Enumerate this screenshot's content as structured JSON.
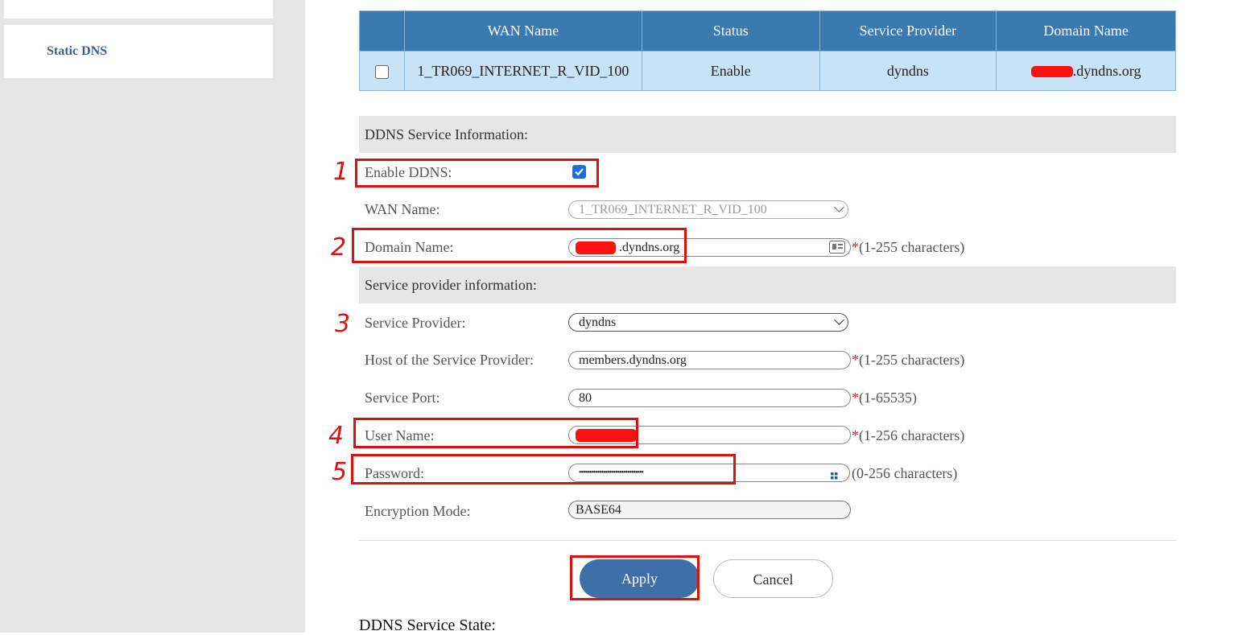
{
  "sidebar": {
    "items": [
      {
        "label": ""
      },
      {
        "label": "Static DNS"
      }
    ]
  },
  "wan_table": {
    "headers": [
      "",
      "WAN Name",
      "Status",
      "Service Provider",
      "Domain Name"
    ],
    "rows": [
      {
        "checked": false,
        "wan_name": "1_TR069_INTERNET_R_VID_100",
        "status": "Enable",
        "provider": "dyndns",
        "domain": ".dyndns.org"
      }
    ]
  },
  "ddns_section": {
    "title": "DDNS Service Information:"
  },
  "form": {
    "enable_ddns": {
      "label": "Enable DDNS:",
      "checked": true
    },
    "wan_name": {
      "label": "WAN Name:",
      "value": "1_TR069_INTERNET_R_VID_100"
    },
    "domain_name": {
      "label": "Domain Name:",
      "value": ".dyndns.org",
      "hint": "(1-255 characters)"
    },
    "service_provider": {
      "label": "Service Provider:",
      "value": "dyndns"
    },
    "host": {
      "label": "Host of the Service Provider:",
      "value": "members.dyndns.org",
      "hint": "(1-255 characters)"
    },
    "port": {
      "label": "Service Port:",
      "value": "80",
      "hint": "(1-65535)"
    },
    "user_name": {
      "label": "User Name:",
      "value": "",
      "hint": "(1-256 characters)"
    },
    "password": {
      "label": "Password:",
      "value": "••••••••••••••••••••••••••••••••",
      "hint": "(0-256 characters)"
    },
    "encryption": {
      "label": "Encryption Mode:",
      "value": "BASE64"
    }
  },
  "provider_section": {
    "title": "Service provider information:"
  },
  "required_mark": "*",
  "buttons": {
    "apply": "Apply",
    "cancel": "Cancel"
  },
  "state_title": "DDNS Service State:",
  "annotations": [
    "1",
    "2",
    "3",
    "4",
    "5"
  ],
  "colors": {
    "accent": "#3a7ab0",
    "apply": "#3f6fa8",
    "annotation": "#e01010"
  }
}
